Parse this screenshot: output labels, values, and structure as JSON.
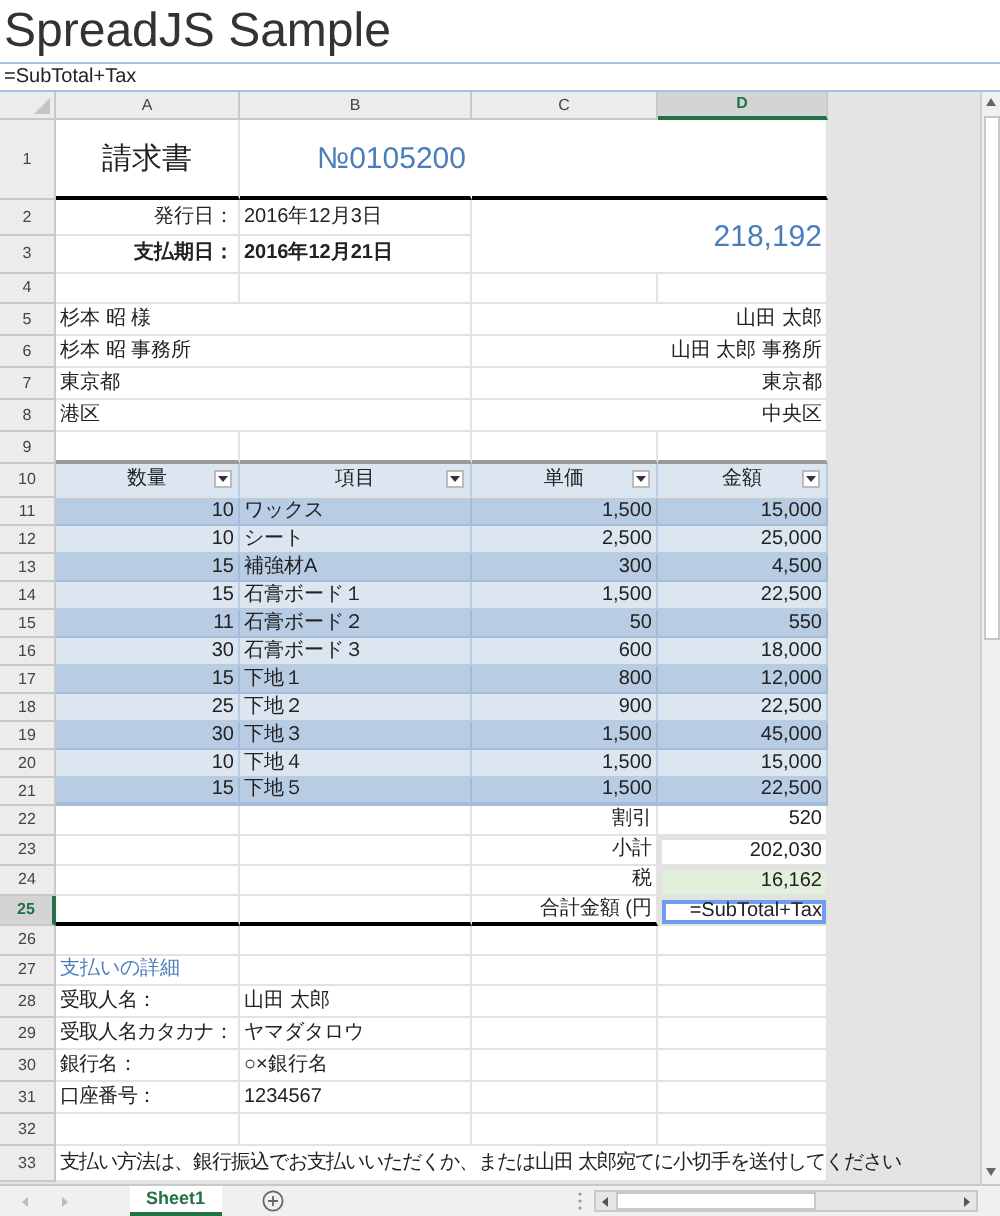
{
  "title": "SpreadJS Sample",
  "formula_bar": {
    "value": "=SubTotal+Tax"
  },
  "columns": [
    {
      "label": "A",
      "selected": false
    },
    {
      "label": "B",
      "selected": false
    },
    {
      "label": "C",
      "selected": false
    },
    {
      "label": "D",
      "selected": true
    }
  ],
  "row_headers": [
    {
      "label": "1",
      "selected": false
    },
    {
      "label": "2",
      "selected": false
    },
    {
      "label": "3",
      "selected": false
    },
    {
      "label": "4",
      "selected": false
    },
    {
      "label": "5",
      "selected": false
    },
    {
      "label": "6",
      "selected": false
    },
    {
      "label": "7",
      "selected": false
    },
    {
      "label": "8",
      "selected": false
    },
    {
      "label": "9",
      "selected": false
    },
    {
      "label": "10",
      "selected": false
    },
    {
      "label": "11",
      "selected": false
    },
    {
      "label": "12",
      "selected": false
    },
    {
      "label": "13",
      "selected": false
    },
    {
      "label": "14",
      "selected": false
    },
    {
      "label": "15",
      "selected": false
    },
    {
      "label": "16",
      "selected": false
    },
    {
      "label": "17",
      "selected": false
    },
    {
      "label": "18",
      "selected": false
    },
    {
      "label": "19",
      "selected": false
    },
    {
      "label": "20",
      "selected": false
    },
    {
      "label": "21",
      "selected": false
    },
    {
      "label": "22",
      "selected": false
    },
    {
      "label": "23",
      "selected": false
    },
    {
      "label": "24",
      "selected": false
    },
    {
      "label": "25",
      "selected": true
    },
    {
      "label": "26",
      "selected": false
    },
    {
      "label": "27",
      "selected": false
    },
    {
      "label": "28",
      "selected": false
    },
    {
      "label": "29",
      "selected": false
    },
    {
      "label": "30",
      "selected": false
    },
    {
      "label": "31",
      "selected": false
    },
    {
      "label": "32",
      "selected": false
    },
    {
      "label": "33",
      "selected": false
    }
  ],
  "invoice": {
    "title": "請求書",
    "number": "№0105200",
    "issue_label": "発行日：",
    "issue_date": "2016年12月3日",
    "due_label": "支払期日：",
    "due_date": "2016年12月21日",
    "total": "218,192"
  },
  "addresses": [
    {
      "left": "杉本 昭 様",
      "right": "山田 太郎"
    },
    {
      "left": "杉本 昭 事務所",
      "right": "山田 太郎 事務所"
    },
    {
      "left": "東京都",
      "right": "東京都"
    },
    {
      "left": "港区",
      "right": "中央区"
    }
  ],
  "table": {
    "columns": [
      {
        "label": "数量"
      },
      {
        "label": "項目"
      },
      {
        "label": "単価"
      },
      {
        "label": "金額"
      }
    ],
    "rows": [
      [
        "10",
        "ワックス",
        "1,500",
        "15,000"
      ],
      [
        "10",
        "シート",
        "2,500",
        "25,000"
      ],
      [
        "15",
        "補強材A",
        "300",
        "4,500"
      ],
      [
        "15",
        "石膏ボード１",
        "1,500",
        "22,500"
      ],
      [
        "11",
        "石膏ボード２",
        "50",
        "550"
      ],
      [
        "30",
        "石膏ボード３",
        "600",
        "18,000"
      ],
      [
        "15",
        "下地１",
        "800",
        "12,000"
      ],
      [
        "25",
        "下地２",
        "900",
        "22,500"
      ],
      [
        "30",
        "下地３",
        "1,500",
        "45,000"
      ],
      [
        "10",
        "下地４",
        "1,500",
        "15,000"
      ],
      [
        "15",
        "下地５",
        "1,500",
        "22,500"
      ]
    ]
  },
  "summary": [
    {
      "label": "割引",
      "value": "520",
      "kind": "plain"
    },
    {
      "label": "小計",
      "value": "202,030",
      "kind": "referenced"
    },
    {
      "label": "税",
      "value": "16,162",
      "kind": "range"
    },
    {
      "label": "合計金額 (円",
      "kind": "active",
      "editor": "=SubTotal+Tax"
    }
  ],
  "payment": {
    "heading": "支払いの詳細",
    "items": [
      {
        "label": "受取人名：",
        "value": "山田 太郎"
      },
      {
        "label": "受取人名カタカナ：",
        "value": "ヤマダタロウ"
      },
      {
        "label": "銀行名：",
        "value": "○×銀行名"
      },
      {
        "label": "口座番号：",
        "value": "1234567"
      }
    ],
    "note": "支払い方法は、銀行振込でお支払いいただくか、または山田 太郎宛てに小切手を送付してください"
  },
  "sheet_tabs": [
    {
      "label": "Sheet1",
      "selected": true
    }
  ]
}
